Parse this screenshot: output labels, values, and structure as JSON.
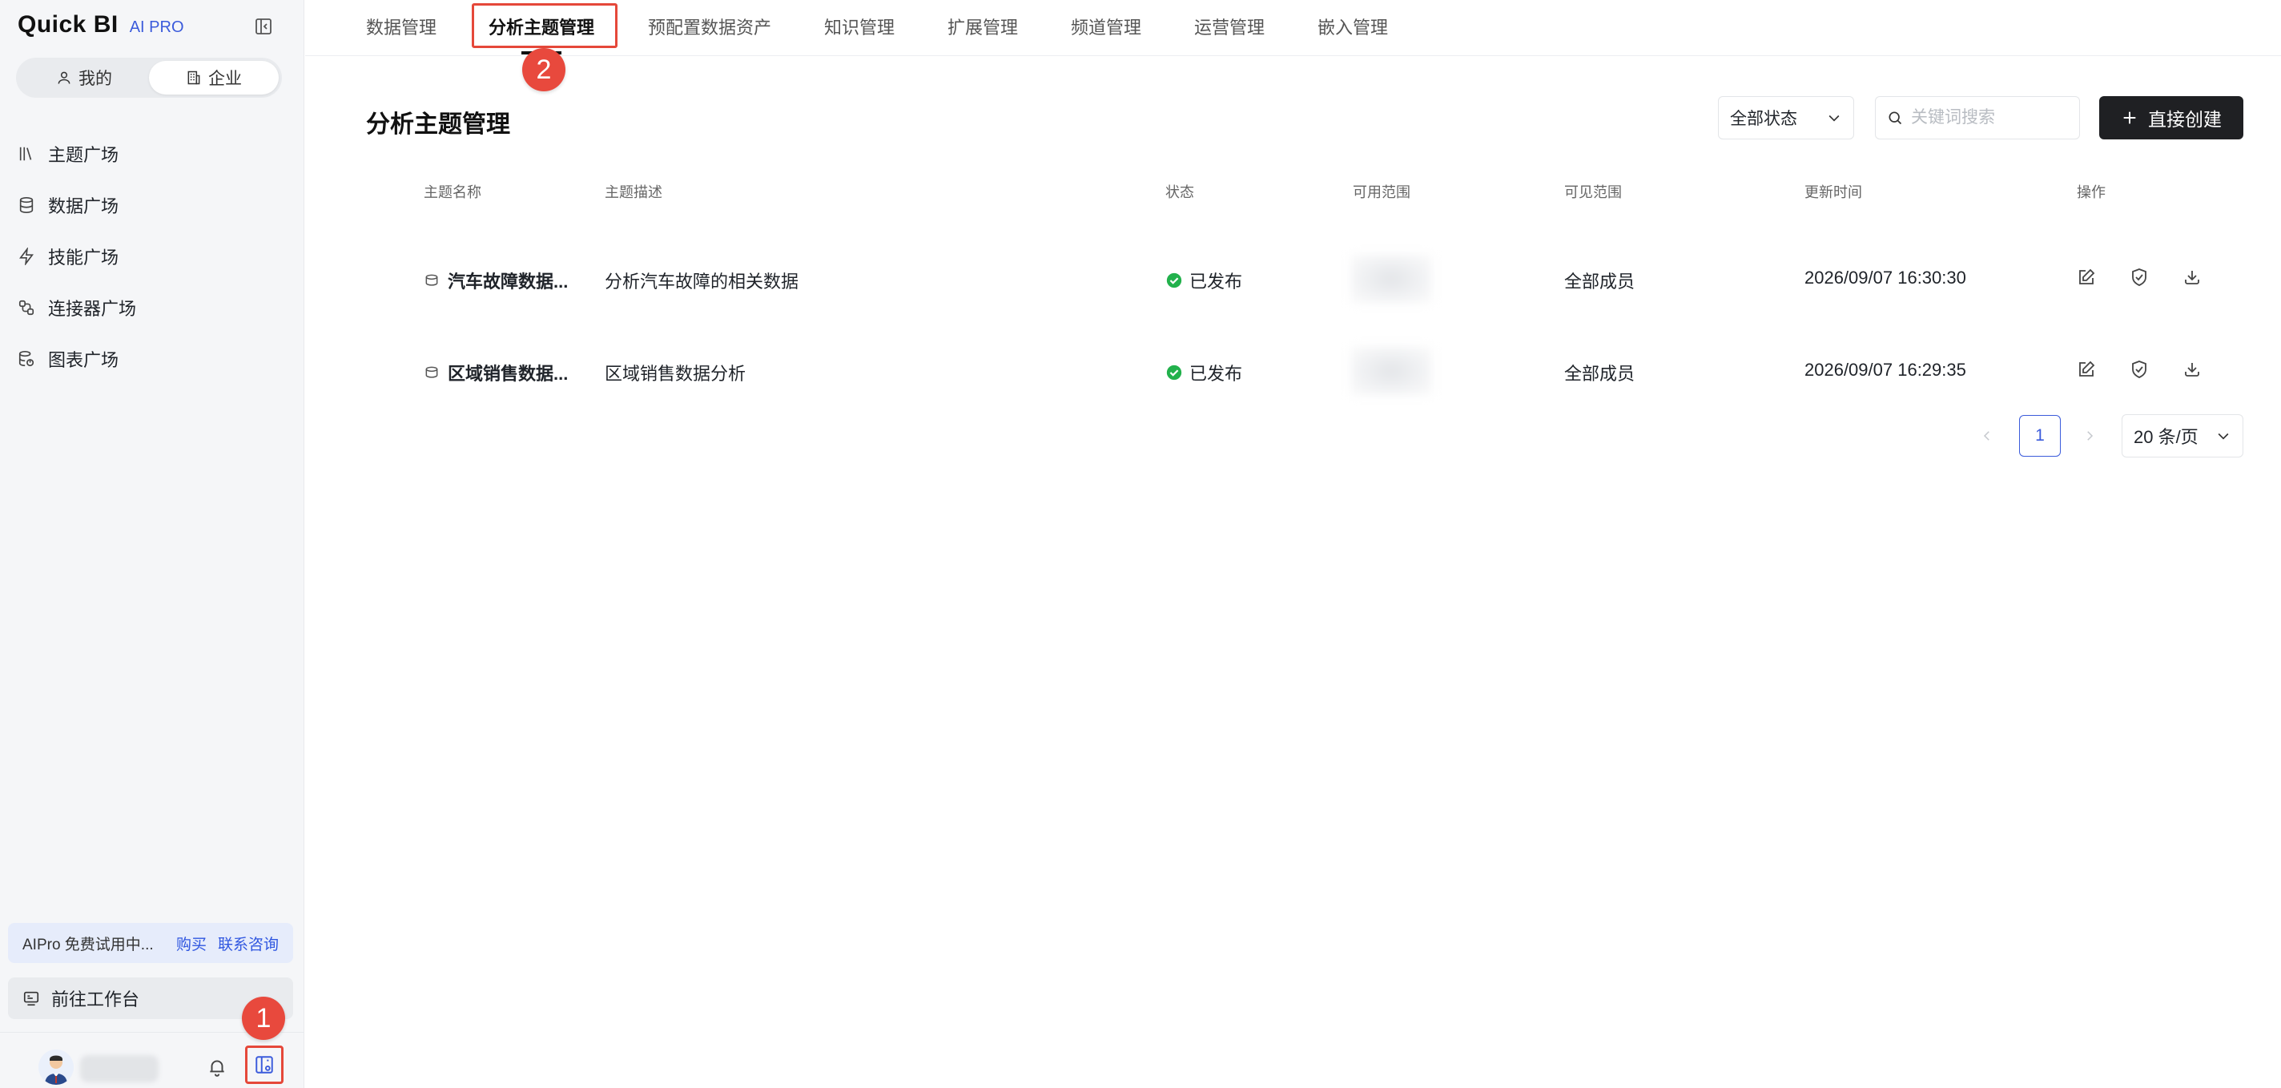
{
  "app": {
    "logo": "Quick BI",
    "edition": "AI PRO"
  },
  "sidebar": {
    "segments": [
      {
        "label": "我的",
        "icon": "user-icon",
        "active": false
      },
      {
        "label": "企业",
        "icon": "building-icon",
        "active": true
      }
    ],
    "nav": [
      {
        "label": "主题广场",
        "icon": "books-icon"
      },
      {
        "label": "数据广场",
        "icon": "database-icon"
      },
      {
        "label": "技能广场",
        "icon": "lightning-icon"
      },
      {
        "label": "连接器广场",
        "icon": "connector-icon"
      },
      {
        "label": "图表广场",
        "icon": "chart-database-icon"
      }
    ],
    "trial": {
      "text": "AIPro 免费试用中...",
      "buy": "购买",
      "contact": "联系咨询"
    },
    "workbench": {
      "label": "前往工作台"
    }
  },
  "annotations": {
    "badge1": "1",
    "badge2": "2"
  },
  "tabs": [
    {
      "label": "数据管理",
      "active": false
    },
    {
      "label": "分析主题管理",
      "active": true
    },
    {
      "label": "预配置数据资产",
      "active": false
    },
    {
      "label": "知识管理",
      "active": false
    },
    {
      "label": "扩展管理",
      "active": false
    },
    {
      "label": "频道管理",
      "active": false
    },
    {
      "label": "运营管理",
      "active": false
    },
    {
      "label": "嵌入管理",
      "active": false
    }
  ],
  "page": {
    "title": "分析主题管理",
    "status_filter": "全部状态",
    "search_placeholder": "关键词搜索",
    "create_label": "直接创建"
  },
  "table": {
    "columns": [
      "主题名称",
      "主题描述",
      "状态",
      "可用范围",
      "可见范围",
      "更新时间",
      "操作"
    ],
    "rows": [
      {
        "name": "汽车故障数据...",
        "desc": "分析汽车故障的相关数据",
        "status": "已发布",
        "visible": "全部成员",
        "updated": "2026/09/07 16:30:30"
      },
      {
        "name": "区域销售数据...",
        "desc": "区域销售数据分析",
        "status": "已发布",
        "visible": "全部成员",
        "updated": "2026/09/07 16:29:35"
      }
    ]
  },
  "pagination": {
    "current": "1",
    "page_size": "20 条/页"
  },
  "colors": {
    "accent": "#3b5bdb",
    "highlight": "#e5483a",
    "success": "#22b14c",
    "primary_button": "#1f2023"
  }
}
